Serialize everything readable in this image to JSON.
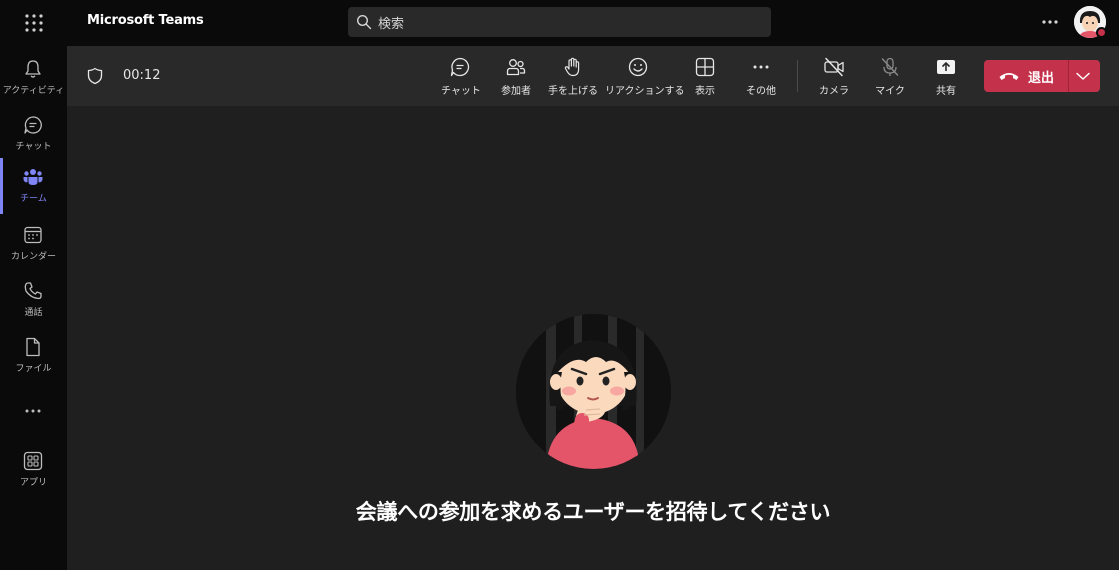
{
  "app": {
    "title": "Microsoft Teams"
  },
  "search": {
    "text": "検索"
  },
  "rail": {
    "items": [
      {
        "label": "アクティビティ",
        "icon": "bell-icon"
      },
      {
        "label": "チャット",
        "icon": "chat-icon"
      },
      {
        "label": "チーム",
        "icon": "teams-icon",
        "active": true
      },
      {
        "label": "カレンダー",
        "icon": "calendar-icon"
      },
      {
        "label": "通話",
        "icon": "phone-icon"
      },
      {
        "label": "ファイル",
        "icon": "file-icon"
      },
      {
        "label": "アプリ",
        "icon": "apps-icon"
      }
    ]
  },
  "meeting": {
    "timer": "00:12",
    "buttons": {
      "chat": "チャット",
      "participants": "参加者",
      "raise_hand": "手を上げる",
      "react": "リアクションする",
      "view": "表示",
      "more": "その他",
      "camera": "カメラ",
      "mic": "マイク",
      "share": "共有"
    },
    "leave_label": "退出"
  },
  "stage": {
    "invite_text": "会議への参加を求めるユーザーを招待してください"
  },
  "colors": {
    "accent": "#7f85f5",
    "leave": "#c4314b",
    "toolbar": "#292929",
    "rail": "#0a0a0a",
    "stage": "#1f1f1f"
  }
}
